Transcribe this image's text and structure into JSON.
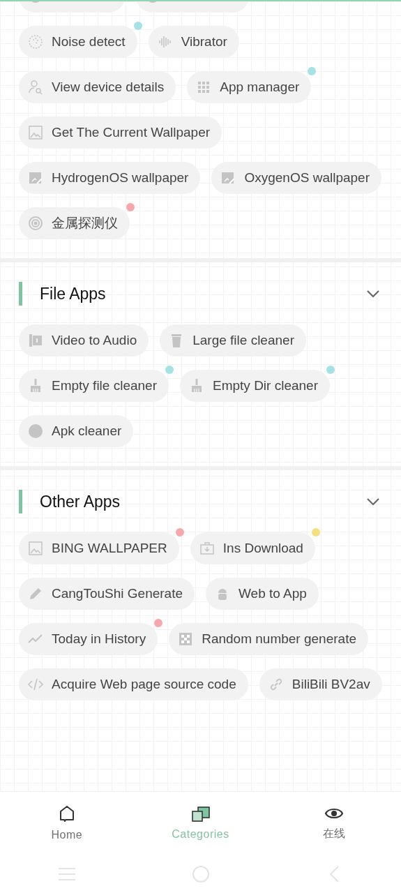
{
  "sections": [
    {
      "items": [
        {
          "kind": "cut"
        },
        {
          "kind": "cut"
        },
        {
          "kind": "app",
          "label": "Noise detect",
          "color": "#a4e2e6"
        },
        {
          "kind": "app",
          "label": "Vibrator"
        },
        {
          "kind": "app",
          "label": "View device details"
        },
        {
          "kind": "app",
          "label": "App manager",
          "color": "#a4e2e6"
        },
        {
          "kind": "app",
          "label": "Get The Current Wallpaper"
        },
        {
          "kind": "app",
          "label": "HydrogenOS wallpaper"
        },
        {
          "kind": "app",
          "label": "OxygenOS wallpaper"
        },
        {
          "kind": "app",
          "label": "金属探测仪",
          "color": "#f5a9a9"
        }
      ]
    },
    {
      "title": "File Apps",
      "items": [
        {
          "kind": "app",
          "label": "Video to Audio"
        },
        {
          "kind": "app",
          "label": "Large file cleaner"
        },
        {
          "kind": "app",
          "label": "Empty file cleaner",
          "color": "#a4e2e6"
        },
        {
          "kind": "app",
          "label": "Empty Dir cleaner",
          "color": "#a4e2e6"
        },
        {
          "kind": "app",
          "label": "Apk cleaner"
        }
      ]
    },
    {
      "title": "Other Apps",
      "items": [
        {
          "kind": "app",
          "label": "BING WALLPAPER",
          "color": "#f5a9a9"
        },
        {
          "kind": "app",
          "label": "Ins Download",
          "color": "#f7df80"
        },
        {
          "kind": "app",
          "label": "CangTouShi Generate"
        },
        {
          "kind": "app",
          "label": "Web to App"
        },
        {
          "kind": "app",
          "label": "Today in History",
          "color": "#f5a9a9"
        },
        {
          "kind": "app",
          "label": "Random number generate"
        },
        {
          "kind": "app",
          "label": "Acquire Web page source code"
        },
        {
          "kind": "app",
          "label": "BiliBili BV2av"
        }
      ]
    }
  ],
  "nav": [
    {
      "label": "Home",
      "selected": false
    },
    {
      "label": "Categories",
      "selected": true
    },
    {
      "label": "在线",
      "selected": false
    }
  ]
}
